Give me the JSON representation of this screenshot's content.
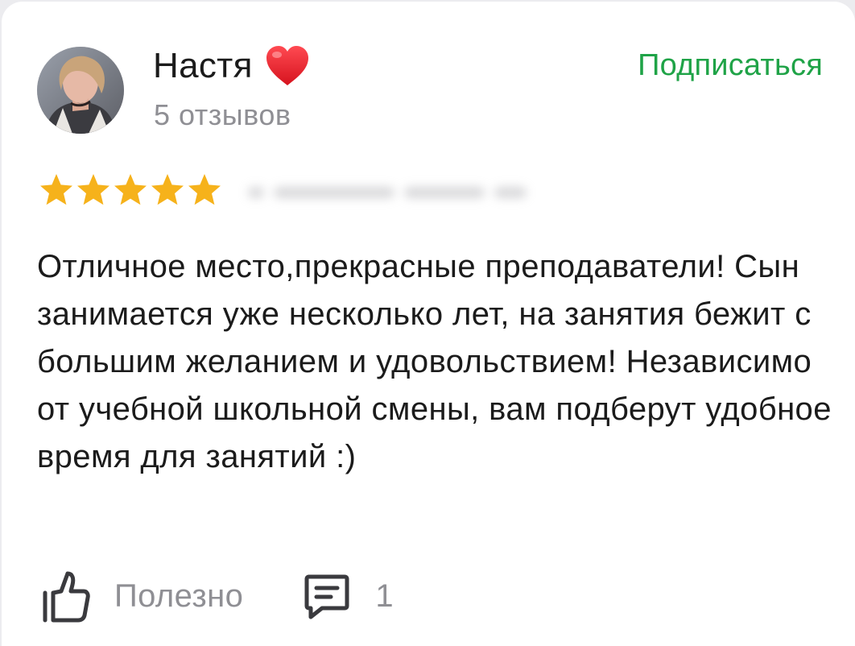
{
  "review": {
    "author": {
      "name": "Настя",
      "emoji_icon": "red-heart-icon",
      "reviews_count_text": "5 отзывов"
    },
    "subscribe_label": "Подписаться",
    "rating": {
      "stars": 5,
      "max": 5
    },
    "text": "Отличное место,прекрасные преподаватели! Сын занимается уже несколько лет, на занятия бежит с большим желанием и удовольствием! Независимо от учебной школьной смены, вам подберут удобное время для занятий :)",
    "actions": {
      "useful_label": "Полезно",
      "comments_count": "1"
    }
  },
  "colors": {
    "accent_green": "#1fa347",
    "star_yellow": "#f6b21b",
    "secondary_gray": "#8f8f94",
    "heart_red": "#e5232e"
  }
}
